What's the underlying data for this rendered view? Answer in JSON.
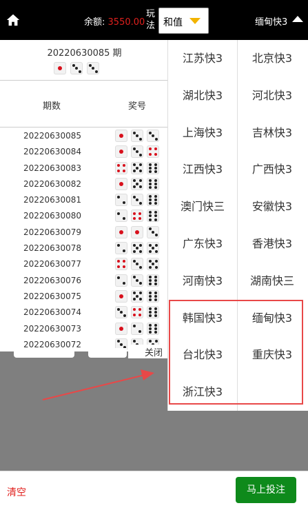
{
  "header": {
    "balance_label": "余额:",
    "balance_value": "3550.00",
    "play_label": "玩法",
    "play_value": "和值",
    "lottery_name": "缅甸快3"
  },
  "current": {
    "issue": "20220630085 期",
    "dice": [
      1,
      3,
      3
    ]
  },
  "history": {
    "col_issue": "期数",
    "col_number": "奖号",
    "rows": [
      {
        "issue": "20220630085",
        "dice": [
          1,
          3,
          3
        ]
      },
      {
        "issue": "20220630084",
        "dice": [
          1,
          3,
          4
        ]
      },
      {
        "issue": "20220630083",
        "dice": [
          4,
          5,
          6
        ]
      },
      {
        "issue": "20220630082",
        "dice": [
          1,
          5,
          6
        ]
      },
      {
        "issue": "20220630081",
        "dice": [
          2,
          3,
          6
        ]
      },
      {
        "issue": "20220630080",
        "dice": [
          2,
          4,
          6
        ]
      },
      {
        "issue": "20220630079",
        "dice": [
          1,
          1,
          3
        ]
      },
      {
        "issue": "20220630078",
        "dice": [
          2,
          5,
          5
        ]
      },
      {
        "issue": "20220630077",
        "dice": [
          4,
          3,
          5
        ]
      },
      {
        "issue": "20220630076",
        "dice": [
          2,
          3,
          6
        ]
      },
      {
        "issue": "20220630075",
        "dice": [
          1,
          5,
          6
        ]
      },
      {
        "issue": "20220630074",
        "dice": [
          3,
          4,
          6
        ]
      },
      {
        "issue": "20220630073",
        "dice": [
          1,
          2,
          6
        ]
      },
      {
        "issue": "20220630072",
        "dice": [
          3,
          3,
          5
        ]
      }
    ]
  },
  "close_label": "关闭",
  "lotteries": [
    "江苏快3",
    "北京快3",
    "湖北快3",
    "河北快3",
    "上海快3",
    "吉林快3",
    "江西快3",
    "广西快3",
    "澳门快三",
    "安徽快3",
    "广东快3",
    "香港快3",
    "河南快3",
    "湖南快三",
    "韩国快3",
    "缅甸快3",
    "台北快3",
    "重庆快3",
    "浙江快3"
  ],
  "footer": {
    "clear_label": "清空",
    "bet_label": "马上投注"
  },
  "colors": {
    "accent_red": "#e0201d",
    "bet_green": "#0e8a1b",
    "highlight_red": "#e84848",
    "play_arrow": "#f2b300"
  },
  "icons": {
    "home": "home-icon",
    "play_dropdown": "triangle-down-icon",
    "lottery_toggle": "triangle-up-icon"
  }
}
